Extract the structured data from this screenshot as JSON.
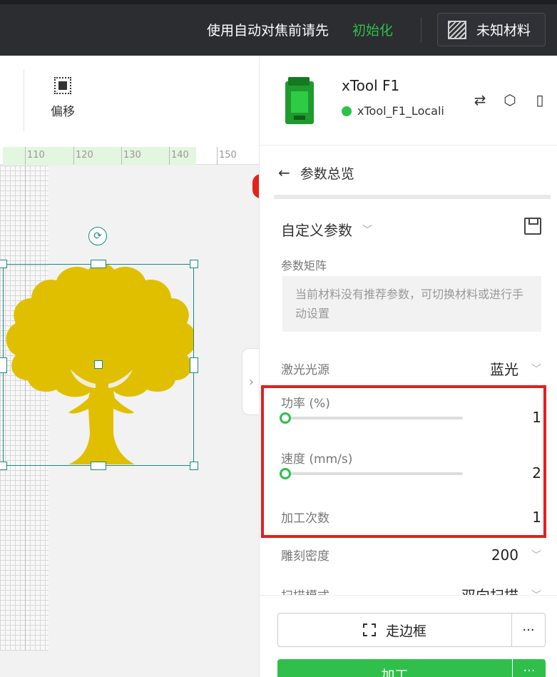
{
  "topbar": {
    "notice": "使用自动对焦前请先",
    "init_link": "初始化",
    "material_label": "未知材料"
  },
  "toolbar": {
    "offset_label": "偏移"
  },
  "ruler": {
    "labels": [
      "110",
      "120",
      "130",
      "140",
      "150"
    ]
  },
  "device": {
    "name": "xTool F1",
    "connection": "xTool_F1_Locali",
    "status_color": "#2bc24a",
    "icons": [
      "swap-icon",
      "settings-hex-icon",
      "document-icon"
    ]
  },
  "panel": {
    "header": "参数总览",
    "preset_name": "自定义参数",
    "matrix_label": "参数矩阵",
    "matrix_hint": "当前材料没有推荐参数，可切换材料或进行手动设置",
    "laser_source_label": "激光光源",
    "laser_source_value": "蓝光",
    "power_label": "功率 (%)",
    "power_value": "1",
    "speed_label": "速度 (mm/s)",
    "speed_value": "2",
    "passes_label": "加工次数",
    "passes_value": "1",
    "density_label": "雕刻密度",
    "density_value": "200",
    "scan_mode_label": "扫描模式",
    "scan_mode_value": "双向扫描"
  },
  "footer": {
    "frame_label": "走边框",
    "process_label": "加工",
    "more_label": "···"
  },
  "colors": {
    "accent": "#2fbf4a",
    "highlight_border": "#e02020",
    "tree": "#e0bf00",
    "selection": "#1a8a80"
  }
}
